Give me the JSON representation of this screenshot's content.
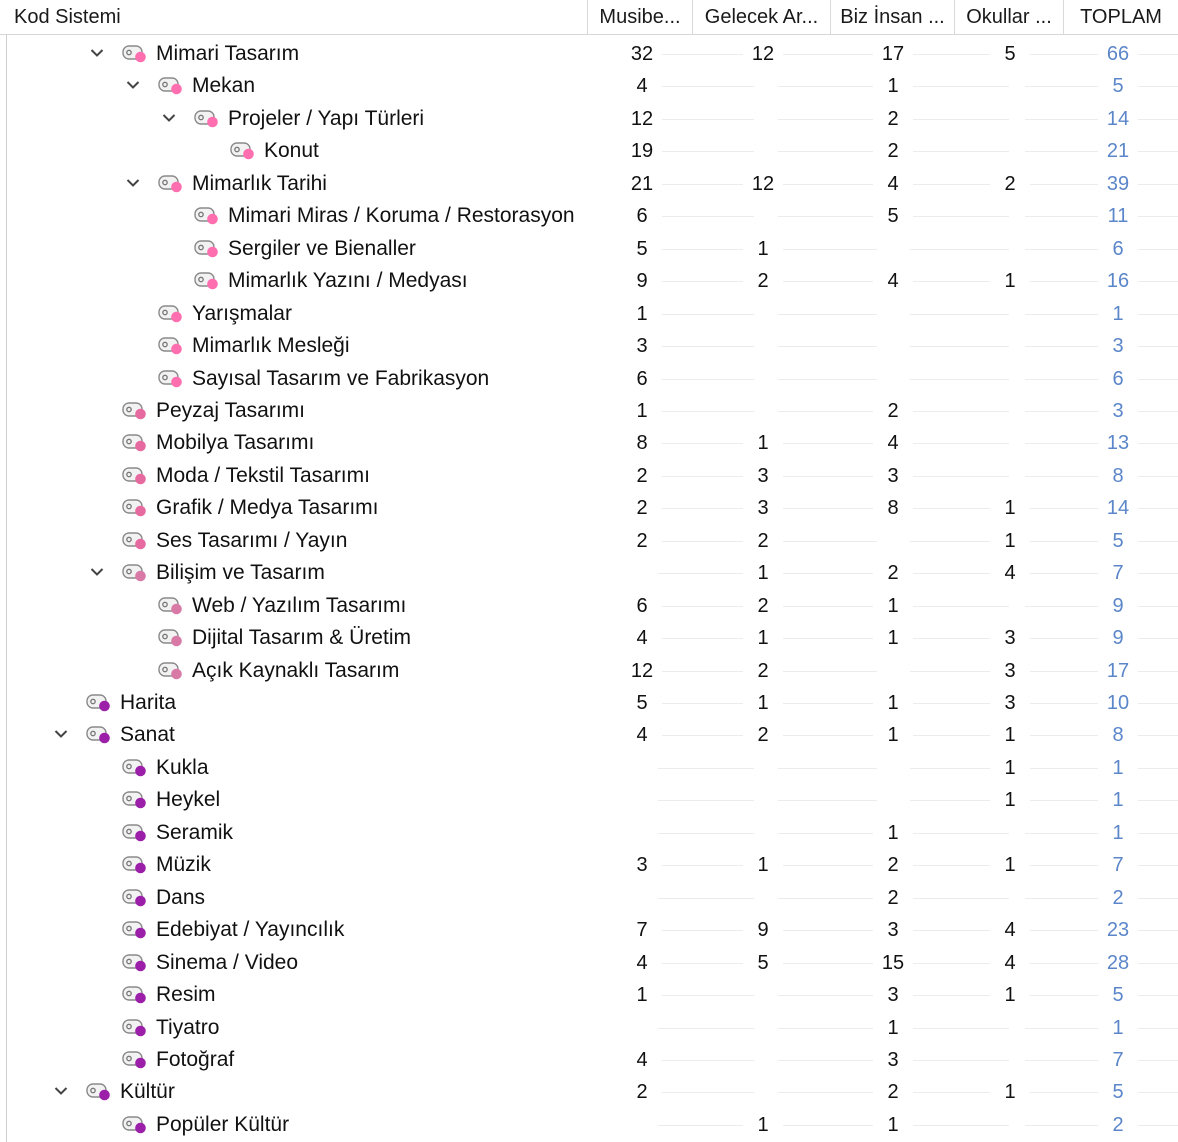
{
  "header": {
    "code_system": "Kod Sistemi",
    "columns": [
      "Musibe...",
      "Gelecek Ar...",
      "Biz İnsan ...",
      "Okullar ...",
      "TOPLAM"
    ]
  },
  "colors": {
    "light_pink": "#ff6fb0",
    "mid_pink": "#e66aa0",
    "dusty_pink": "#d97aa6",
    "purple": "#9b1fa8",
    "total_text": "#5b86c9"
  },
  "rows": [
    {
      "level": 2,
      "expanded": true,
      "color": "light_pink",
      "label": "Mimari Tasarım",
      "values": [
        "32",
        "12",
        "17",
        "5"
      ],
      "total": "66"
    },
    {
      "level": 3,
      "expanded": true,
      "color": "light_pink",
      "label": "Mekan",
      "values": [
        "4",
        "",
        "1",
        ""
      ],
      "total": "5"
    },
    {
      "level": 4,
      "expanded": true,
      "color": "light_pink",
      "label": "Projeler / Yapı Türleri",
      "values": [
        "12",
        "",
        "2",
        ""
      ],
      "total": "14"
    },
    {
      "level": 5,
      "expanded": false,
      "color": "light_pink",
      "label": "Konut",
      "values": [
        "19",
        "",
        "2",
        ""
      ],
      "total": "21"
    },
    {
      "level": 3,
      "expanded": true,
      "color": "light_pink",
      "label": "Mimarlık Tarihi",
      "values": [
        "21",
        "12",
        "4",
        "2"
      ],
      "total": "39"
    },
    {
      "level": 4,
      "expanded": false,
      "color": "light_pink",
      "label": "Mimari Miras / Koruma / Restorasyon",
      "values": [
        "6",
        "",
        "5",
        ""
      ],
      "total": "11"
    },
    {
      "level": 4,
      "expanded": false,
      "color": "light_pink",
      "label": "Sergiler ve Bienaller",
      "values": [
        "5",
        "1",
        "",
        ""
      ],
      "total": "6"
    },
    {
      "level": 4,
      "expanded": false,
      "color": "light_pink",
      "label": "Mimarlık Yazını / Medyası",
      "values": [
        "9",
        "2",
        "4",
        "1"
      ],
      "total": "16"
    },
    {
      "level": 3,
      "expanded": false,
      "color": "light_pink",
      "label": "Yarışmalar",
      "values": [
        "1",
        "",
        "",
        ""
      ],
      "total": "1"
    },
    {
      "level": 3,
      "expanded": false,
      "color": "light_pink",
      "label": "Mimarlık Mesleği",
      "values": [
        "3",
        "",
        "",
        ""
      ],
      "total": "3"
    },
    {
      "level": 3,
      "expanded": false,
      "color": "light_pink",
      "label": "Sayısal Tasarım ve Fabrikasyon",
      "values": [
        "6",
        "",
        "",
        ""
      ],
      "total": "6"
    },
    {
      "level": 2,
      "expanded": false,
      "color": "mid_pink",
      "label": "Peyzaj Tasarımı",
      "values": [
        "1",
        "",
        "2",
        ""
      ],
      "total": "3"
    },
    {
      "level": 2,
      "expanded": false,
      "color": "mid_pink",
      "label": "Mobilya Tasarımı",
      "values": [
        "8",
        "1",
        "4",
        ""
      ],
      "total": "13"
    },
    {
      "level": 2,
      "expanded": false,
      "color": "mid_pink",
      "label": "Moda / Tekstil Tasarımı",
      "values": [
        "2",
        "3",
        "3",
        ""
      ],
      "total": "8"
    },
    {
      "level": 2,
      "expanded": false,
      "color": "mid_pink",
      "label": "Grafik / Medya Tasarımı",
      "values": [
        "2",
        "3",
        "8",
        "1"
      ],
      "total": "14"
    },
    {
      "level": 2,
      "expanded": false,
      "color": "mid_pink",
      "label": "Ses Tasarımı / Yayın",
      "values": [
        "2",
        "2",
        "",
        "1"
      ],
      "total": "5"
    },
    {
      "level": 2,
      "expanded": true,
      "color": "dusty_pink",
      "label": "Bilişim ve Tasarım",
      "values": [
        "",
        "1",
        "2",
        "4"
      ],
      "total": "7"
    },
    {
      "level": 3,
      "expanded": false,
      "color": "dusty_pink",
      "label": "Web / Yazılım Tasarımı",
      "values": [
        "6",
        "2",
        "1",
        ""
      ],
      "total": "9"
    },
    {
      "level": 3,
      "expanded": false,
      "color": "dusty_pink",
      "label": "Dijital Tasarım & Üretim",
      "values": [
        "4",
        "1",
        "1",
        "3"
      ],
      "total": "9"
    },
    {
      "level": 3,
      "expanded": false,
      "color": "dusty_pink",
      "label": "Açık Kaynaklı Tasarım",
      "values": [
        "12",
        "2",
        "",
        "3"
      ],
      "total": "17"
    },
    {
      "level": 1,
      "expanded": false,
      "color": "purple",
      "label": "Harita",
      "values": [
        "5",
        "1",
        "1",
        "3"
      ],
      "total": "10"
    },
    {
      "level": 1,
      "expanded": true,
      "color": "purple",
      "label": "Sanat",
      "values": [
        "4",
        "2",
        "1",
        "1"
      ],
      "total": "8"
    },
    {
      "level": 2,
      "expanded": false,
      "color": "purple",
      "label": "Kukla",
      "values": [
        "",
        "",
        "",
        "1"
      ],
      "total": "1"
    },
    {
      "level": 2,
      "expanded": false,
      "color": "purple",
      "label": "Heykel",
      "values": [
        "",
        "",
        "",
        "1"
      ],
      "total": "1"
    },
    {
      "level": 2,
      "expanded": false,
      "color": "purple",
      "label": "Seramik",
      "values": [
        "",
        "",
        "1",
        ""
      ],
      "total": "1"
    },
    {
      "level": 2,
      "expanded": false,
      "color": "purple",
      "label": "Müzik",
      "values": [
        "3",
        "1",
        "2",
        "1"
      ],
      "total": "7"
    },
    {
      "level": 2,
      "expanded": false,
      "color": "purple",
      "label": "Dans",
      "values": [
        "",
        "",
        "2",
        ""
      ],
      "total": "2"
    },
    {
      "level": 2,
      "expanded": false,
      "color": "purple",
      "label": "Edebiyat / Yayıncılık",
      "values": [
        "7",
        "9",
        "3",
        "4"
      ],
      "total": "23"
    },
    {
      "level": 2,
      "expanded": false,
      "color": "purple",
      "label": "Sinema / Video",
      "values": [
        "4",
        "5",
        "15",
        "4"
      ],
      "total": "28"
    },
    {
      "level": 2,
      "expanded": false,
      "color": "purple",
      "label": "Resim",
      "values": [
        "1",
        "",
        "3",
        "1"
      ],
      "total": "5"
    },
    {
      "level": 2,
      "expanded": false,
      "color": "purple",
      "label": "Tiyatro",
      "values": [
        "",
        "",
        "1",
        ""
      ],
      "total": "1"
    },
    {
      "level": 2,
      "expanded": false,
      "color": "purple",
      "label": "Fotoğraf",
      "values": [
        "4",
        "",
        "3",
        ""
      ],
      "total": "7"
    },
    {
      "level": 1,
      "expanded": true,
      "color": "purple",
      "label": "Kültür",
      "values": [
        "2",
        "",
        "2",
        "1"
      ],
      "total": "5"
    },
    {
      "level": 2,
      "expanded": false,
      "color": "purple",
      "label": "Popüler Kültür",
      "values": [
        "",
        "1",
        "1",
        ""
      ],
      "total": "2"
    }
  ]
}
